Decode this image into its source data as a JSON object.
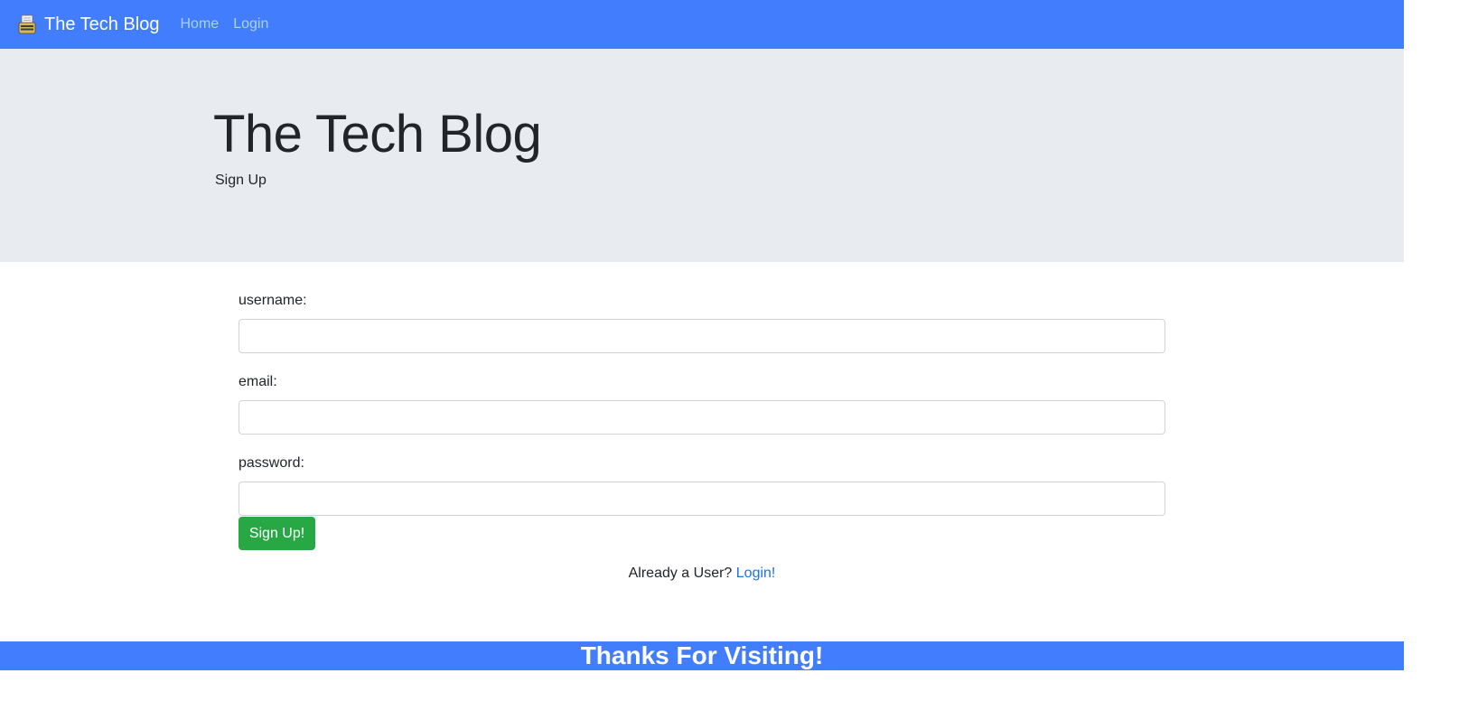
{
  "navbar": {
    "brand": "The Tech Blog",
    "brand_icon": "typewriter-icon",
    "links": [
      "Home",
      "Login"
    ],
    "color": "#427dfd"
  },
  "jumbotron": {
    "title": "The Tech Blog",
    "subtitle": "Sign Up"
  },
  "form": {
    "username_label": "username:",
    "username_value": "",
    "email_label": "email:",
    "email_value": "",
    "password_label": "password:",
    "password_value": "",
    "submit_label": "Sign Up!"
  },
  "already": {
    "text": "Already a User?",
    "link": "Login!"
  },
  "footer": {
    "text": "Thanks For Visiting!"
  }
}
